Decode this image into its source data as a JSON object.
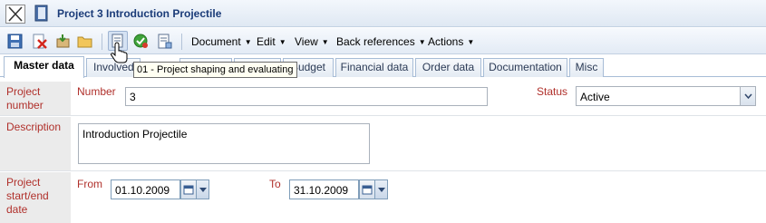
{
  "window": {
    "title": "Project 3 Introduction Projectile"
  },
  "toolbar": {
    "icons": [
      "save-icon",
      "delete-icon",
      "new-icon",
      "open-folder-icon",
      "print-icon",
      "check-refresh-icon",
      "report-icon"
    ],
    "menus": [
      {
        "label": "Document"
      },
      {
        "label": "Edit"
      },
      {
        "label": "View"
      },
      {
        "label": "Back references"
      },
      {
        "label": "Actions"
      }
    ]
  },
  "tooltip": {
    "text": "01 - Project shaping and evaluating"
  },
  "tabs": [
    {
      "label": "Master data",
      "active": true
    },
    {
      "label": "Involved"
    },
    {
      "label": ""
    },
    {
      "label": ""
    },
    {
      "label": "Budget"
    },
    {
      "label": "Financial data"
    },
    {
      "label": "Order data"
    },
    {
      "label": "Documentation"
    },
    {
      "label": "Misc"
    }
  ],
  "form": {
    "project_number": {
      "label": "Project number",
      "number_label": "Number",
      "number_value": "3",
      "status_label": "Status",
      "status_value": "Active"
    },
    "description": {
      "label": "Description",
      "value": "Introduction Projectile"
    },
    "dates": {
      "label": "Project start/end date",
      "from_label": "From",
      "from_value": "01.10.2009",
      "to_label": "To",
      "to_value": "31.10.2009"
    }
  },
  "colors": {
    "label_red": "#b0302b",
    "title_blue": "#1a3b78",
    "toolbar_bg": "#e3ebf5"
  }
}
